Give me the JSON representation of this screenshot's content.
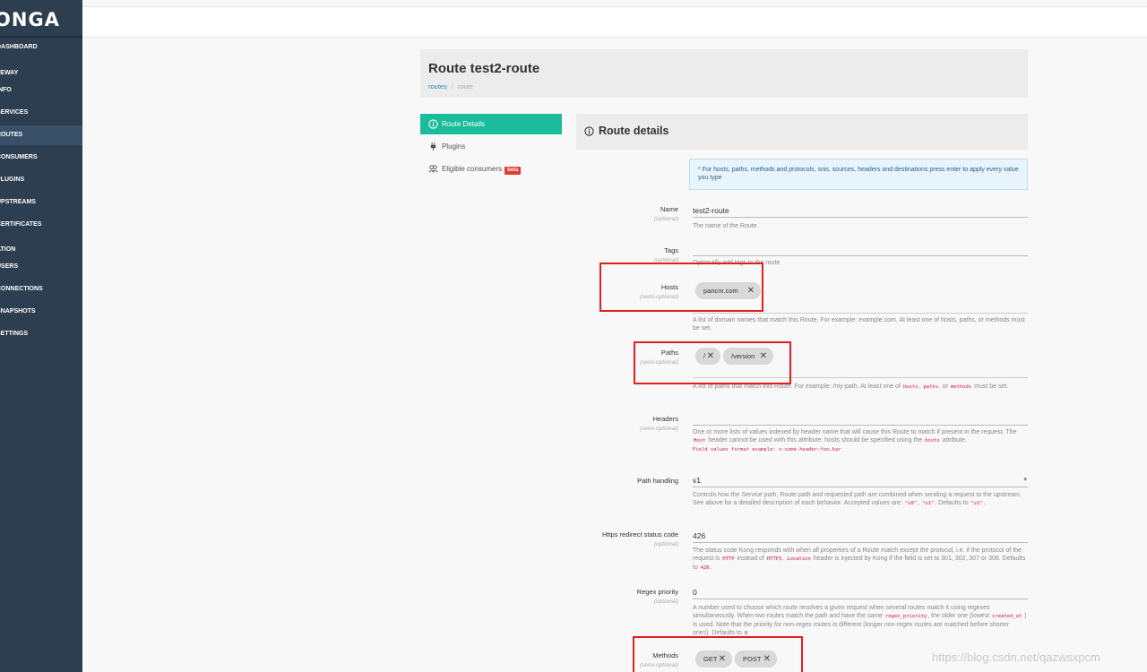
{
  "sidebar": {
    "logo": "ONGA",
    "items": [
      {
        "label": "DASHBOARD"
      },
      {
        "label": "TEWAY"
      },
      {
        "label": "INFO"
      },
      {
        "label": "SERVICES"
      },
      {
        "label": "ROUTES"
      },
      {
        "label": "CONSUMERS"
      },
      {
        "label": "PLUGINS"
      },
      {
        "label": "UPSTREAMS"
      },
      {
        "label": "CERTIFICATES"
      },
      {
        "label": "ATION"
      },
      {
        "label": "USERS"
      },
      {
        "label": "CONNECTIONS"
      },
      {
        "label": "SNAPSHOTS"
      },
      {
        "label": "SETTINGS"
      }
    ],
    "active_item": "ROUTES"
  },
  "header": {
    "title": "Route test2-route",
    "breadcrumb": {
      "link": "routes",
      "separator": "/",
      "current": "route"
    }
  },
  "tabs": [
    {
      "label": "Route Details"
    },
    {
      "label": "Plugins"
    },
    {
      "label": "Eligible consumers",
      "badge": "beta"
    }
  ],
  "details": {
    "title": "Route details",
    "info": "* For hosts, paths, methods and protocols, snis, sources, headers and destinations press enter to apply every value you type"
  },
  "fields": {
    "name": {
      "label": "Name",
      "sub": "(optional)",
      "value": "test2-route",
      "help": "The name of the Route."
    },
    "tags": {
      "label": "Tags",
      "sub": "(optional)",
      "value": "",
      "help": "Optionally add tags to the route"
    },
    "hosts": {
      "label": "Hosts",
      "sub": "(semi-optional)",
      "chips": [
        "pancm.com"
      ],
      "help": "A list of domain names that match this Route. For example: example.com. At least one of hosts, paths, or methods must be set."
    },
    "paths": {
      "label": "Paths",
      "sub": "(semi-optional)",
      "chips": [
        "/",
        "/version"
      ],
      "help_a": "A list of paths that match this Route. For example: /my-path. At least one of",
      "code1": "hosts",
      "sep1": ",",
      "code2": "paths",
      "sep2": ", or",
      "code3": "methods",
      "help_b": "must be set."
    },
    "headers": {
      "label": "Headers",
      "sub": "(semi-optional)",
      "help_a": "One or more lists of values indexed by header name that will cause this Route to match if present in the request. The",
      "code1": "Host",
      "help_b": "header cannot be used with this attribute: hosts should be specified using the",
      "code2": "hosts",
      "help_c": "attribute.",
      "format": "Field values format example: x-some-header:foo,bar"
    },
    "path_handling": {
      "label": "Path handling",
      "value": "v1",
      "arrow": "▾",
      "help_a": "Controls how the Service path, Route path and requested path are combined when sending a request to the upstream. See above for a detailed description of each behavior. Accepted values are:",
      "code1": "\"v0\"",
      "sep1": ",",
      "code2": "\"v1\"",
      "help_b": ". Defaults to",
      "code3": "\"v1\"",
      "end": "."
    },
    "https_redirect": {
      "label": "Https redirect status code",
      "sub": "(optional)",
      "value": "426",
      "help_a": "The status code Kong responds with when all properties of a Route match except the protocol, i.e. if the protocol of the request is",
      "code1": "HTTP",
      "help_b": "instead of",
      "code2": "HTTPS",
      "sep": ".",
      "code3": "Location",
      "help_c": "header is injected by Kong if the field is set to 301, 302, 307 or 308. Defaults to",
      "code4": "426",
      "end": "."
    },
    "regex_priority": {
      "label": "Regex priority",
      "sub": "(optional)",
      "value": "0",
      "help_a": "A number used to choose which route resolves a given request when several routes match it using regexes simultaneously. When two routes match the path and have the same",
      "code1": "regex_priority",
      "help_b": ", the older one (lowest",
      "code2": "created_at",
      "help_c": ") is used. Note that the priority for non-regex routes is different (longer non-regex routes are matched before shorter ones). Defaults to",
      "code3": "0",
      "end": "."
    },
    "methods": {
      "label": "Methods",
      "sub": "(semi-optional)",
      "chips": [
        "GET",
        "POST"
      ]
    }
  },
  "watermark": "https://blog.csdn.net/qazwsxpcm",
  "colors": {
    "sidebar": "#2d3e50",
    "accent": "#1bbc9b",
    "highlight": "#e02020",
    "beta": "#e53935"
  }
}
